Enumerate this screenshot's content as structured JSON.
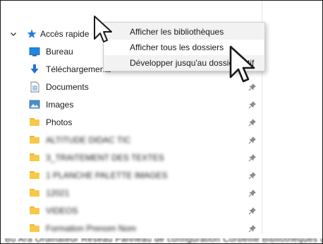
{
  "nav": {
    "quick_access": {
      "label": "Accès rapide",
      "icon": "star-pin-icon",
      "expanded": true
    },
    "items": [
      {
        "label": "Bureau",
        "icon": "desktop-icon",
        "blurred": false
      },
      {
        "label": "Téléchargements",
        "icon": "download-arrow-icon",
        "blurred": false
      },
      {
        "label": "Documents",
        "icon": "document-icon",
        "blurred": false
      },
      {
        "label": "Images",
        "icon": "images-icon",
        "blurred": false
      },
      {
        "label": "Photos",
        "icon": "folder-icon",
        "blurred": false
      },
      {
        "label": "ALTITUDE DIDAC TIC",
        "icon": "folder-icon",
        "blurred": true
      },
      {
        "label": "3_TRAITEMENT DES TEXTES",
        "icon": "folder-icon",
        "blurred": true
      },
      {
        "label": "1 PLANCHE PALETTE IMAGES",
        "icon": "folder-icon",
        "blurred": true
      },
      {
        "label": "12021",
        "icon": "folder-icon",
        "blurred": true
      },
      {
        "label": "VIDEOS",
        "icon": "folder-icon",
        "blurred": true
      },
      {
        "label": "Formation Prenom Nom",
        "icon": "folder-icon",
        "blurred": true
      }
    ],
    "pin_icon": "pin-icon"
  },
  "context_menu": {
    "items": [
      {
        "label": "Afficher les bibliothèques"
      },
      {
        "label": "Afficher tous les dossiers",
        "hovered": true
      },
      {
        "label": "Développer jusqu'au dossier actif"
      }
    ]
  },
  "bottom_text": "Bu Ara Ordinateur Réseau Panneau de configuration Corbeille Bibliothèques Documents",
  "colors": {
    "menu_bg": "#f2f2f2",
    "menu_hover": "#ffffff",
    "folder": "#f6c94a",
    "accent_blue": "#1f7ad6"
  }
}
